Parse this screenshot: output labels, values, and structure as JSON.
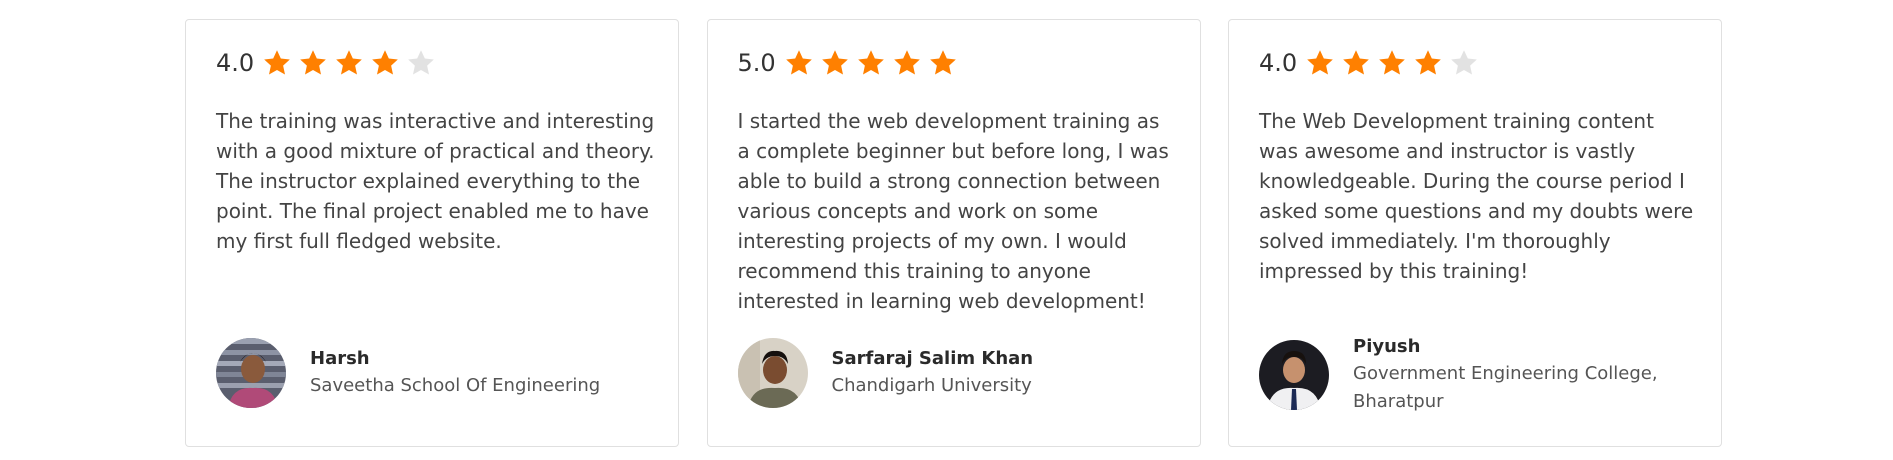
{
  "colors": {
    "star_filled": "#ff8000",
    "star_empty": "#e2e2e2",
    "card_border": "#e0e0e0"
  },
  "reviews": [
    {
      "rating": "4.0",
      "stars_filled": 4,
      "stars_total": 5,
      "text": "The training was interactive and interesting with a good mixture of practical and theory. The instructor explained everything to the point. The final project enabled me to have my first full fledged website.",
      "author": {
        "name": "Harsh",
        "school": "Saveetha School Of Engineering",
        "avatar_icon": "user-photo-avatar"
      }
    },
    {
      "rating": "5.0",
      "stars_filled": 5,
      "stars_total": 5,
      "text": "I started the web development training as a complete beginner but before long, I was able to build a strong connection between various concepts and work on some interesting projects of my own. I would recommend this training to anyone interested in learning web development!",
      "author": {
        "name": "Sarfaraj Salim Khan",
        "school": "Chandigarh University",
        "avatar_icon": "user-photo-avatar"
      }
    },
    {
      "rating": "4.0",
      "stars_filled": 4,
      "stars_total": 5,
      "text": "The Web Development training content was awesome and instructor is vastly knowledgeable. During the course period I asked some questions and my doubts were solved immediately. I'm thoroughly impressed by this training!",
      "author": {
        "name": "Piyush",
        "school": "Government Engineering College, Bharatpur",
        "avatar_icon": "user-photo-avatar"
      }
    }
  ]
}
